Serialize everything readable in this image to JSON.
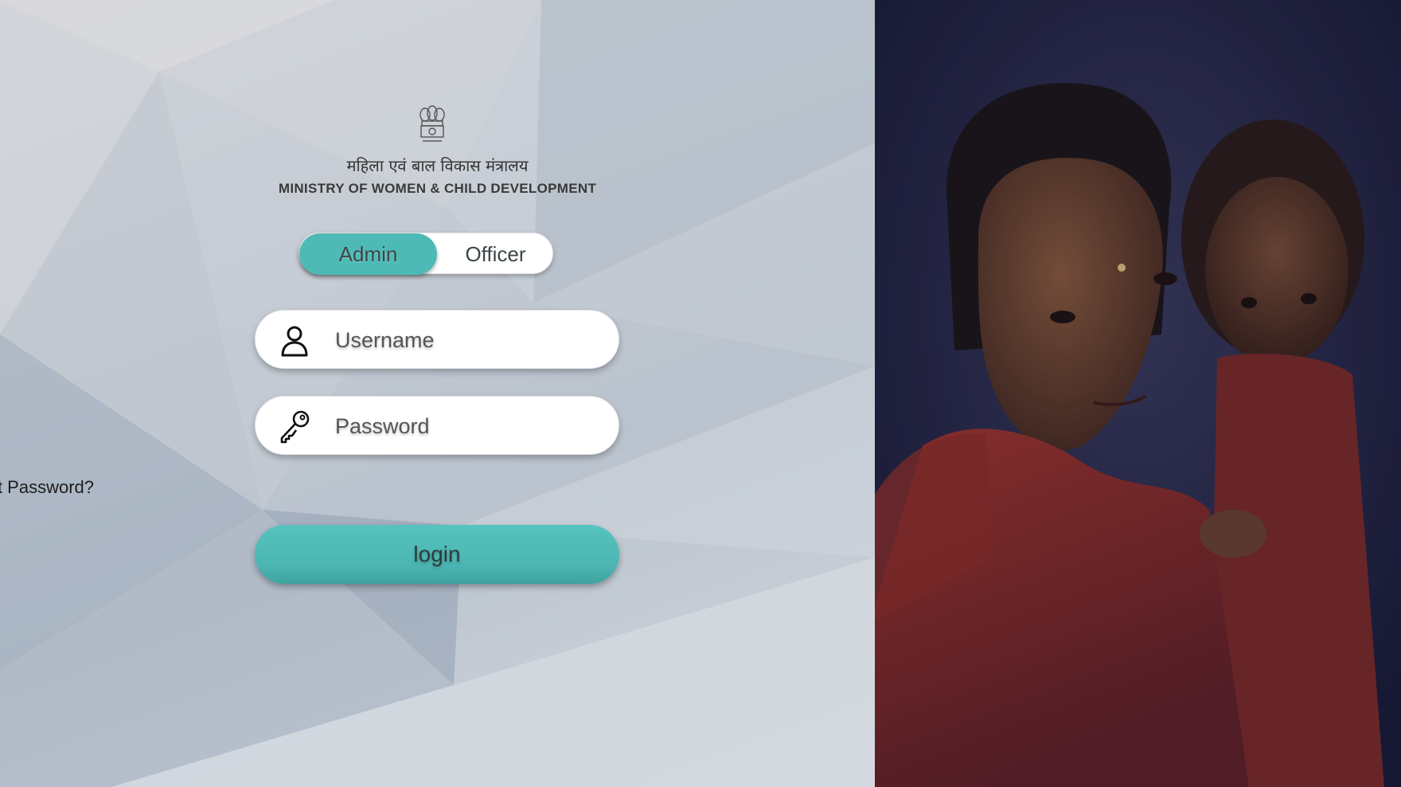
{
  "header": {
    "hindi_title": "महिला एवं बाल विकास मंत्रालय",
    "english_title": "MINISTRY OF WOMEN & CHILD DEVELOPMENT",
    "emblem_icon": "national-emblem-icon"
  },
  "role_toggle": {
    "options": [
      "Admin",
      "Officer"
    ],
    "selected": "Admin"
  },
  "form": {
    "username": {
      "icon": "user-icon",
      "placeholder": "Username",
      "value": ""
    },
    "password": {
      "icon": "key-icon",
      "placeholder": "Password",
      "value": ""
    },
    "forget_password_label": "Forget Password?",
    "login_label": "login"
  },
  "colors": {
    "accent": "#4dbab6",
    "photo_background": "#1f2140"
  },
  "photo": {
    "subject": "mother-and-child-photo"
  }
}
